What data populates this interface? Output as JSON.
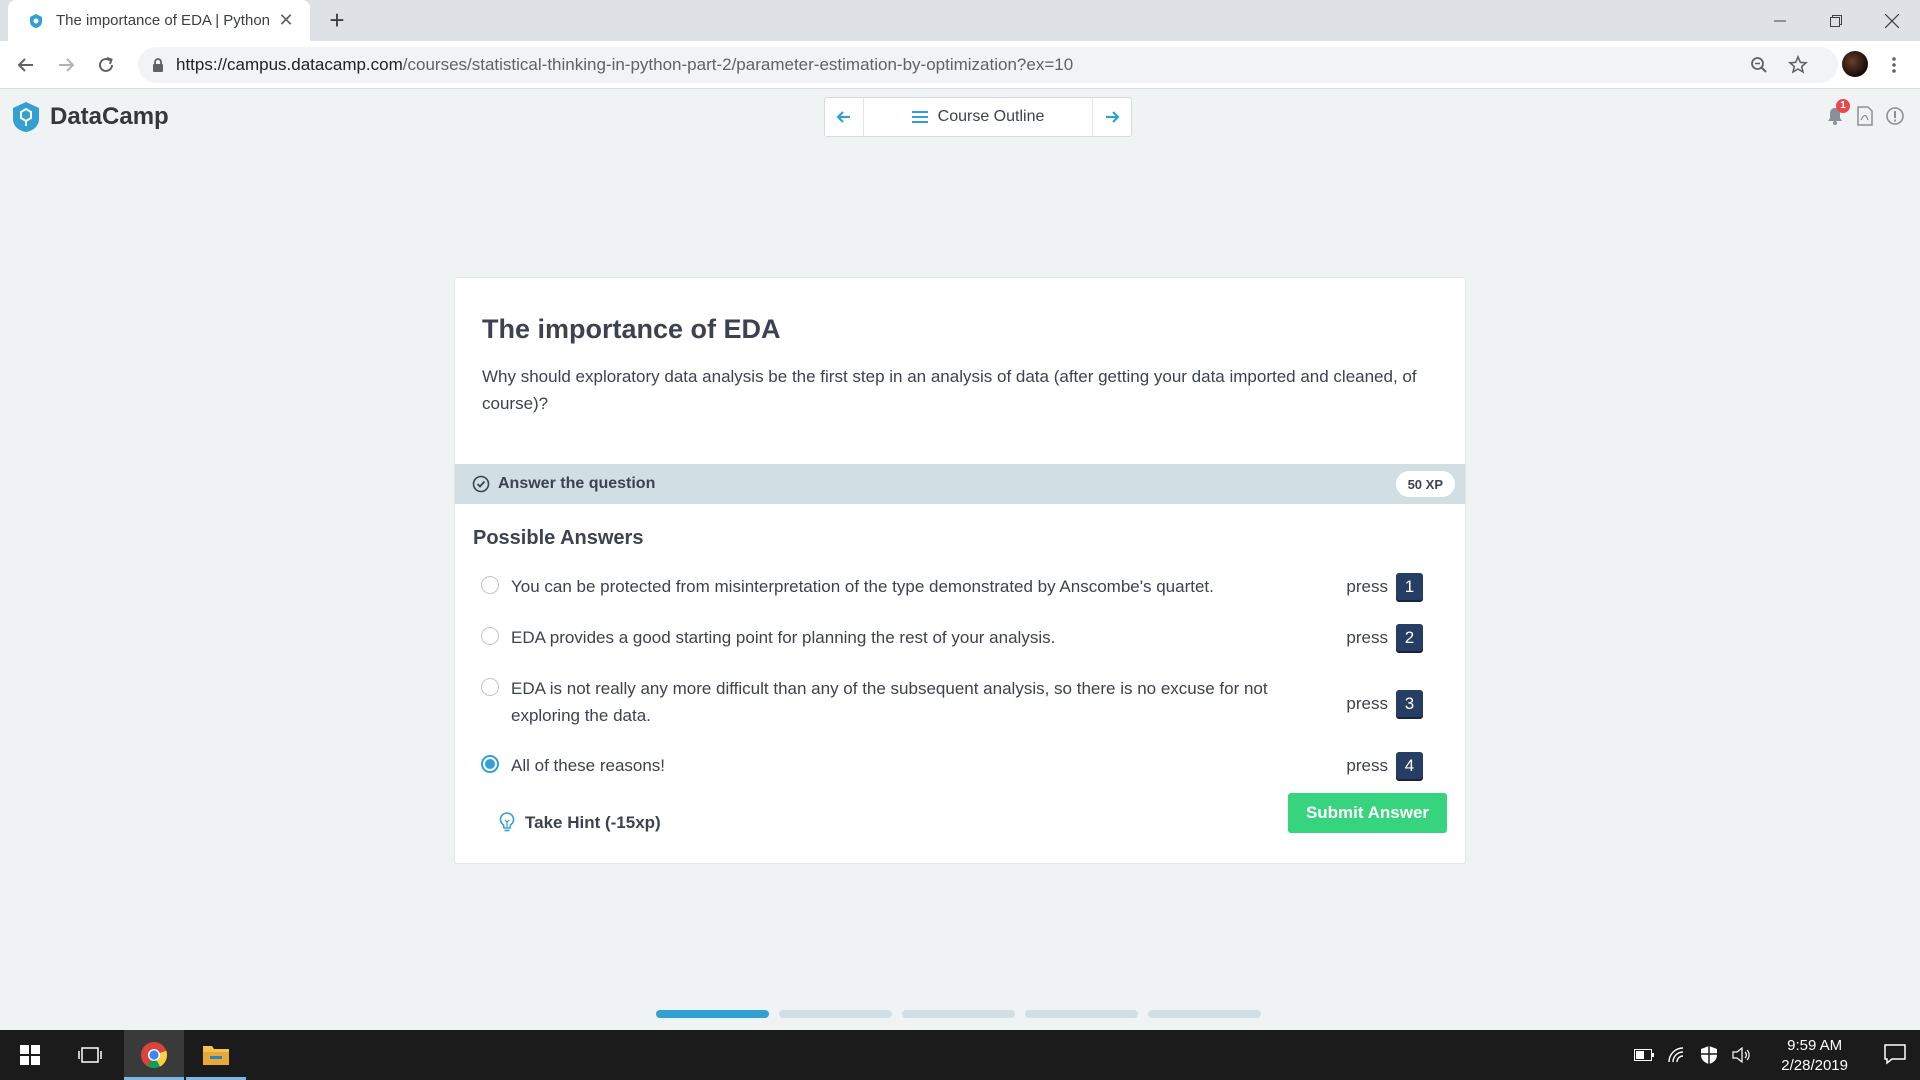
{
  "browser": {
    "tab_title": "The importance of EDA | Python",
    "url_host": "https://campus.datacamp.com",
    "url_path": "/courses/statistical-thinking-in-python-part-2/parameter-estimation-by-optimization?ex=10"
  },
  "header": {
    "logo_text": "DataCamp",
    "course_outline_label": "Course Outline",
    "notification_count": "1"
  },
  "exercise": {
    "title": "The importance of EDA",
    "question": "Why should exploratory data analysis be the first step in an analysis of data (after getting your data imported and cleaned, of course)?",
    "task_label": "Answer the question",
    "xp": "50 XP",
    "possible_answers_title": "Possible Answers",
    "press_label": "press",
    "options": [
      {
        "text": "You can be protected from misinterpretation of the type demonstrated by Anscombe's quartet.",
        "key": "1",
        "selected": false
      },
      {
        "text": "EDA provides a good starting point for planning the rest of your analysis.",
        "key": "2",
        "selected": false
      },
      {
        "text": "EDA is not really any more difficult than any of the subsequent analysis, so there is no excuse for not exploring the data.",
        "key": "3",
        "selected": false
      },
      {
        "text": "All of these reasons!",
        "key": "4",
        "selected": true
      }
    ],
    "hint_label": "Take Hint (-15xp)",
    "submit_label": "Submit Answer"
  },
  "pager": {
    "total": 5,
    "active_index": 0
  },
  "taskbar": {
    "time": "9:59 AM",
    "date": "2/28/2019"
  },
  "colors": {
    "accent": "#33a0d3",
    "submit": "#36d57d",
    "key_bg": "#263e63",
    "answer_bar": "#d1dfe5"
  }
}
